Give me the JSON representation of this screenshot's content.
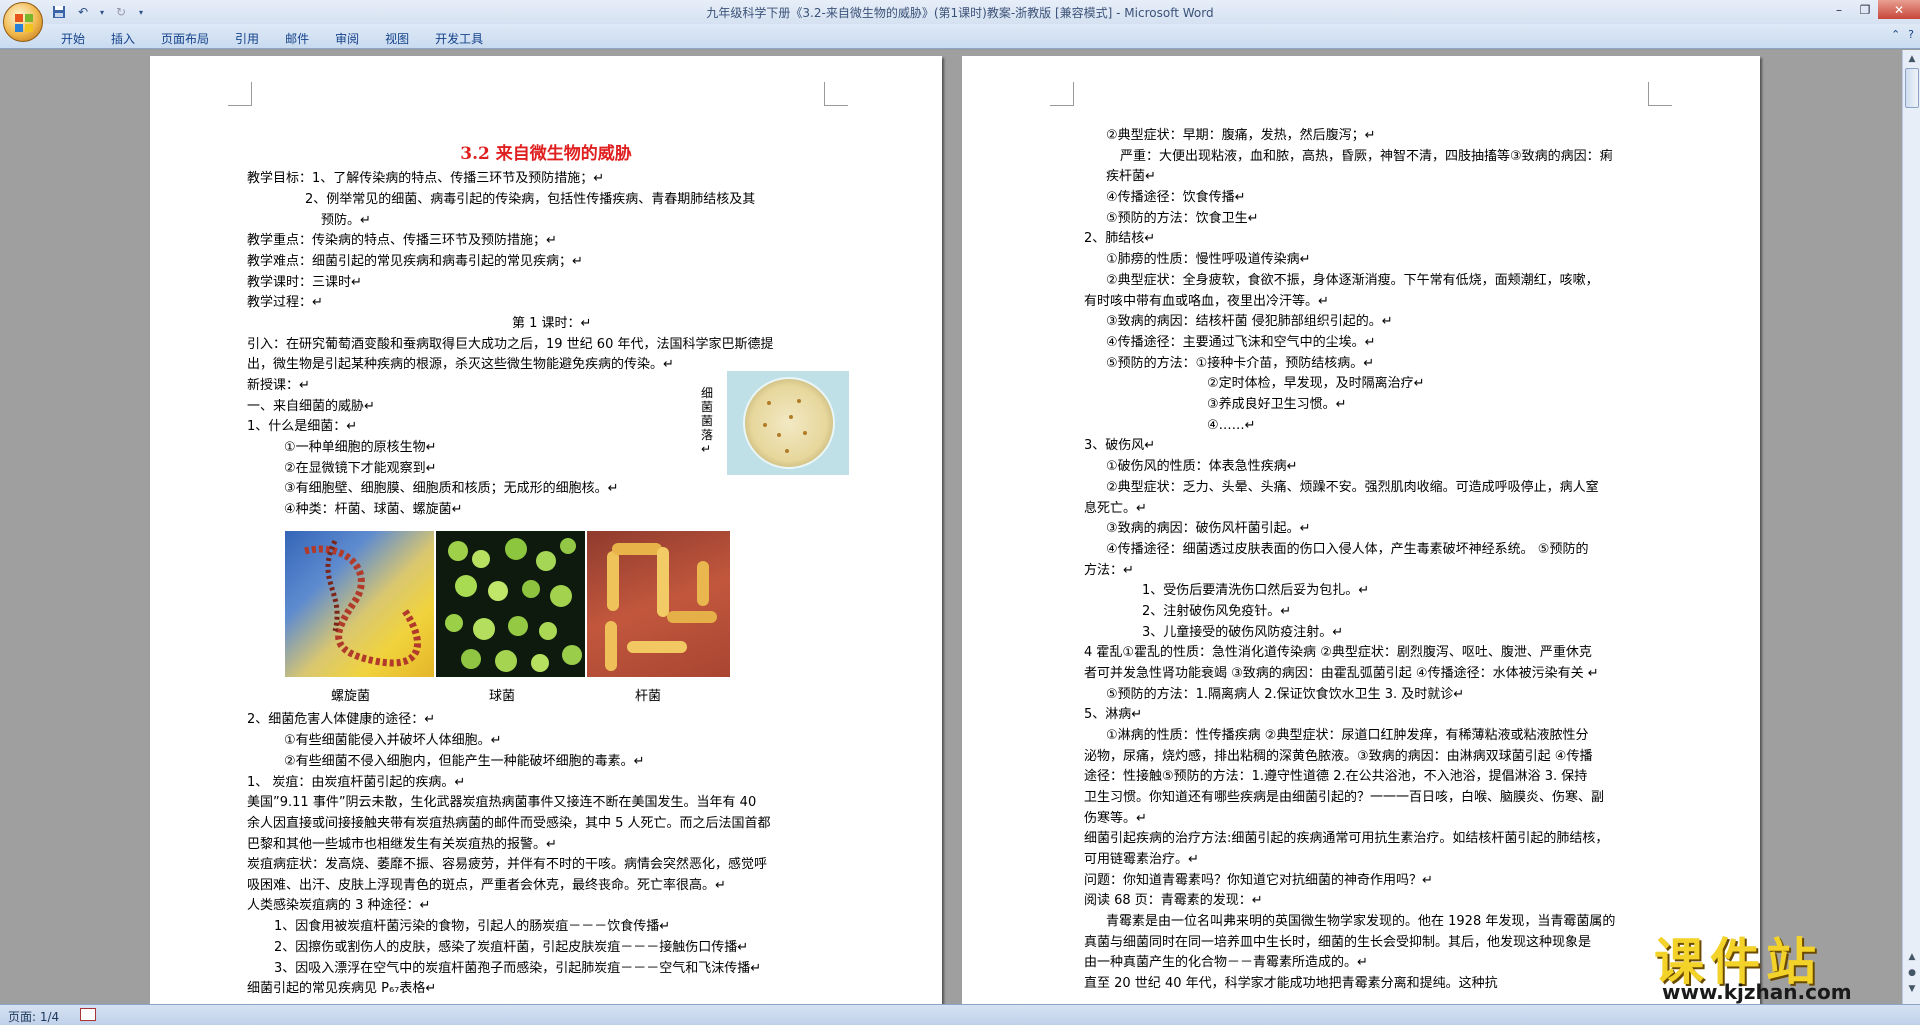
{
  "window": {
    "title": "九年级科学下册《3.2-来自微生物的威胁》(第1课时)教案-浙教版 [兼容模式] - Microsoft Word"
  },
  "qat": {
    "save_icon": "save-icon",
    "undo_icon": "undo-icon",
    "redo_icon": "redo-icon"
  },
  "ribbon": {
    "tabs": [
      "开始",
      "插入",
      "页面布局",
      "引用",
      "邮件",
      "审阅",
      "视图",
      "开发工具"
    ]
  },
  "status": {
    "page": "页面: 1/4"
  },
  "doc": {
    "title": "3.2  来自微生物的威胁",
    "left_lines": [
      "教学目标：1、了解传染病的特点、传播三环节及预防措施；↵",
      "2、例举常见的细菌、病毒引起的传染病，包括性传播疾病、青春期肺结核及其",
      "预防。↵",
      "教学重点：传染病的特点、传播三环节及预防措施；↵",
      "教学难点：细菌引起的常见疾病和病毒引起的常见疾病；↵",
      "教学课时：三课时↵",
      "教学过程：↵",
      "第 1 课时：↵",
      "引入：在研究葡萄酒变酸和蚕病取得巨大成功之后，19 世纪 60 年代，法国科学家巴斯德提",
      "出，微生物是引起某种疾病的根源，杀灭这些微生物能避免疾病的传染。↵",
      "新授课：↵",
      "一、来自细菌的威胁↵",
      "1、什么是细菌：↵",
      "①一种单细胞的原核生物↵",
      "②在显微镜下才能观察到↵",
      "③有细胞壁、细胞膜、细胞质和核质；无成形的细胞核。↵",
      "④种类：杆菌、球菌、螺旋菌↵",
      "2、细菌危害人体健康的途径：↵",
      "①有些细菌能侵入并破坏人体细胞。↵",
      "②有些细菌不侵入细胞内，但能产生一种能破坏细胞的毒素。↵",
      "1、   炭疽：由炭疽杆菌引起的疾病。↵",
      "美国”9.11 事件”阴云未散，生化武器炭疽热病菌事件又接连不断在美国发生。当年有 40",
      "余人因直接或间接接触夹带有炭疽热病菌的邮件而受感染，其中 5 人死亡。而之后法国首都",
      "巴黎和其他一些城市也相继发生有关炭疽热的报警。↵",
      "炭疽病症状：发高烧、萎靡不振、容易疲劳，并伴有不时的干咳。病情会突然恶化，感觉呼",
      "吸困难、出汗、皮肤上浮现青色的斑点，严重者会休克，最终丧命。死亡率很高。↵",
      "人类感染炭疽病的 3 种途径：↵",
      "1、因食用被炭疽杆菌污染的食物，引起人的肠炭疽－－－饮食传播↵",
      "2、因擦伤或割伤人的皮肤，感染了炭疽杆菌，引起皮肤炭疽－－－接触伤口传播↵",
      "3、因吸入漂浮在空气中的炭疽杆菌孢子而感染，引起肺炭疽－－－空气和飞沫传播↵",
      "细菌引起的常见疾病见 P₆₇表格↵"
    ],
    "petri_caption": "细菌菌落↵",
    "image_captions": [
      "螺旋菌",
      "球菌",
      "杆菌"
    ],
    "right_lines": [
      "②典型症状：早期：腹痛，发热，然后腹泻；↵",
      "严重：大便出现粘液，血和脓，高热，昏厥，神智不清，四肢抽搐等③致病的病因：痢",
      "疾杆菌↵",
      "④传播途径：饮食传播↵",
      "⑤预防的方法：饮食卫生↵",
      "2、肺结核↵",
      "①肺痨的性质：慢性呼吸道传染病↵",
      "②典型症状：全身疲软，食欲不振，身体逐渐消瘦。下午常有低烧，面颊潮红，咳嗽，",
      "有时咳中带有血或咯血，夜里出冷汗等。↵",
      "③致病的病因：结核杆菌   侵犯肺部组织引起的。↵",
      "④传播途径：主要通过飞沫和空气中的尘埃。↵",
      "⑤预防的方法：①接种卡介苗，预防结核病。↵",
      "②定时体检，早发现，及时隔离治疗↵",
      "③养成良好卫生习惯。↵",
      "④……↵",
      "3、破伤风↵",
      "①破伤风的性质：体表急性疾病↵",
      "②典型症状：乏力、头晕、头痛、烦躁不安。强烈肌肉收缩。可造成呼吸停止，病人窒",
      "息死亡。↵",
      "③致病的病因：破伤风杆菌引起。↵",
      "④传播途径：细菌透过皮肤表面的伤口入侵人体，产生毒素破坏神经系统。 ⑤预防的",
      "方法：↵",
      "1、受伤后要清洗伤口然后妥为包扎。↵",
      "2、注射破伤风免疫针。↵",
      "3、儿童接受的破伤风防疫注射。↵",
      "4  霍乱①霍乱的性质：急性消化道传染病 ②典型症状：剧烈腹泻、呕吐、腹泄、严重休克",
      "者可并发急性肾功能衰竭 ③致病的病因：由霍乱弧菌引起 ④传播途径：水体被污染有关 ↵",
      "⑤预防的方法：1.隔离病人 2.保证饮食饮水卫生 3. 及时就诊↵",
      "5、淋病↵",
      "①淋病的性质：性传播疾病 ②典型症状：尿道口红肿发痒，有稀薄粘液或粘液脓性分",
      "泌物，尿痛，烧灼感，排出粘稠的深黄色脓液。③致病的病因：由淋病双球菌引起 ④传播",
      "途径：性接触⑤预防的方法：1.遵守性道德 2.在公共浴池，不入池浴，提倡淋浴 3. 保持",
      "卫生习惯。你知道还有哪些疾病是由细菌引起的？一一一百日咳，白喉、脑膜炎、伤寒、副",
      "伤寒等。↵",
      "细菌引起疾病的治疗方法:细菌引起的疾病通常可用抗生素治疗。如结核杆菌引起的肺结核，",
      "可用链霉素治疗。↵",
      "问题：你知道青霉素吗？你知道它对抗细菌的神奇作用吗？↵",
      "阅读 68 页：青霉素的发现：↵",
      "青霉素是由一位名叫弗来明的英国微生物学家发现的。他在 1928 年发现，当青霉菌属的",
      "真菌与细菌同时在同一培养皿中生长时，细菌的生长会受抑制。其后，他发现这种现象是",
      "由一种真菌产生的化合物－－青霉素所造成的。↵",
      "直至 20 世纪 40 年代，科学家才能成功地把青霉素分离和提纯。这种抗"
    ]
  },
  "watermark": {
    "title": "课件站",
    "url": "www.kjzhan.com"
  }
}
